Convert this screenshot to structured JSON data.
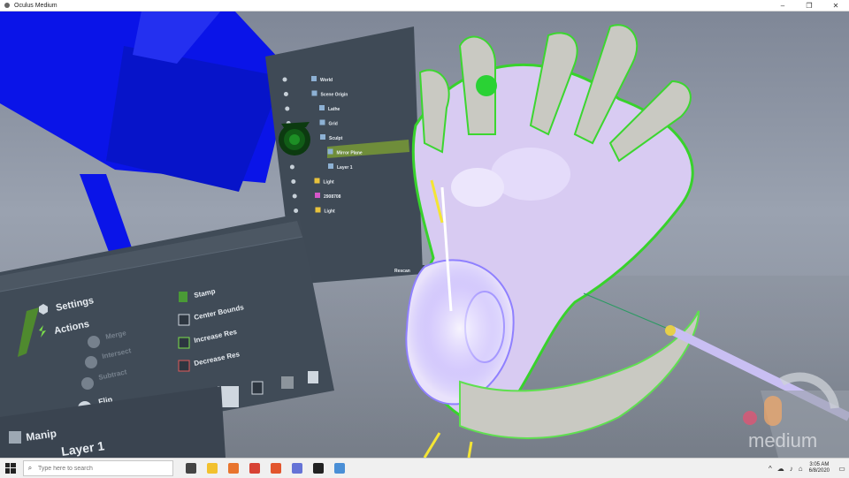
{
  "window": {
    "title": "Oculus Medium",
    "minimize": "–",
    "maximize": "❐",
    "close": "✕"
  },
  "hierarchy": {
    "items": [
      {
        "label": "World"
      },
      {
        "label": "Scene Origin"
      },
      {
        "label": "Lathe"
      },
      {
        "label": "Grid"
      },
      {
        "label": "Sculpt"
      },
      {
        "label": "Mirror Plane"
      },
      {
        "label": "Layer 1"
      },
      {
        "label": "Light"
      },
      {
        "label": "2908708"
      },
      {
        "label": "Light"
      }
    ],
    "footer": "Rescan"
  },
  "tools": {
    "settings": "Settings",
    "actions": "Actions",
    "merge": "Merge",
    "intersect": "Intersect",
    "subtract": "Subtract",
    "flip": "Flip",
    "stamp": "Stamp",
    "center_bounds": "Center Bounds",
    "increase_res": "Increase Res",
    "decrease_res": "Decrease Res",
    "manip": "Manip",
    "layer": "Layer 1"
  },
  "watermark": "medium",
  "taskbar": {
    "search_placeholder": "Type here to search",
    "time": "3:05 AM",
    "date": "6/8/2020",
    "apps": [
      {
        "icon": "task-view-icon",
        "color": "#444444"
      },
      {
        "icon": "file-explorer-icon",
        "color": "#f2c12e"
      },
      {
        "icon": "firefox-icon",
        "color": "#e8742d"
      },
      {
        "icon": "chrome-icon",
        "color": "#d74234"
      },
      {
        "icon": "firefox-alt-icon",
        "color": "#e2552d"
      },
      {
        "icon": "discord-icon",
        "color": "#6573d6"
      },
      {
        "icon": "oculus-icon",
        "color": "#222222"
      },
      {
        "icon": "medium-app-icon",
        "color": "#4a8fd6"
      }
    ]
  },
  "colors": {
    "blue_object": "#0a14e8",
    "panel": "#3f4a56",
    "highlight": "#7db84a",
    "sculpt_purple": "#d9c8f6",
    "sculpt_green": "#3cd630"
  }
}
